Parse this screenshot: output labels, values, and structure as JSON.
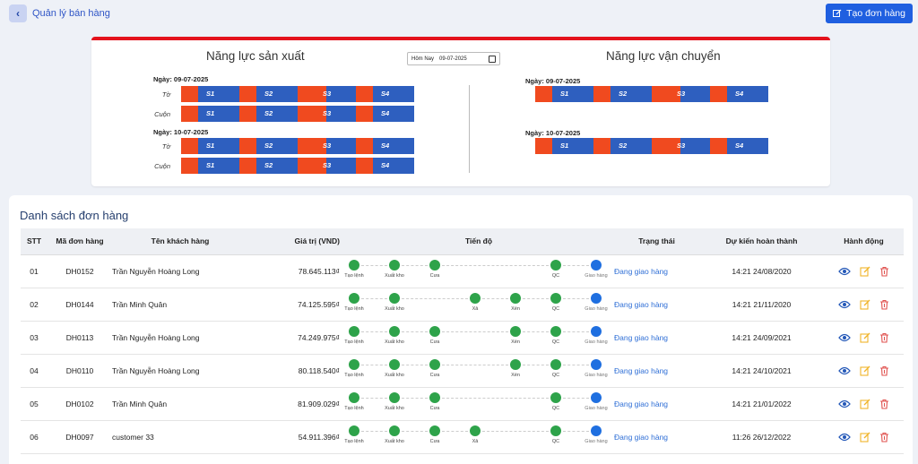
{
  "header": {
    "back_label": "Quản lý bán hàng",
    "create_label": "Tạo đơn hàng"
  },
  "capacity": {
    "production_title": "Năng lực sản xuất",
    "shipping_title": "Năng lực vận chuyển",
    "date_picker": {
      "prefix": "Hôm Nay",
      "value": "09-07-2025"
    },
    "segments": [
      "S1",
      "S2",
      "S3",
      "S4"
    ],
    "production_days": [
      {
        "label": "Ngày: 09-07-2025",
        "rows": [
          "Tờ",
          "Cuộn"
        ]
      },
      {
        "label": "Ngày: 10-07-2025",
        "rows": [
          "Tờ",
          "Cuộn"
        ]
      }
    ],
    "shipping_days": [
      {
        "label": "Ngày: 09-07-2025"
      },
      {
        "label": "Ngày: 10-07-2025"
      }
    ]
  },
  "orders": {
    "title": "Danh sách đơn hàng",
    "columns": [
      "STT",
      "Mã đơn hàng",
      "Tên khách hàng",
      "Giá trị (VND)",
      "Tiến độ",
      "Trạng thái",
      "Dự kiến hoàn thành",
      "Hành động"
    ],
    "step_names": {
      "tao": "Tạo lệnh",
      "xuat": "Xuất kho",
      "cua": "Cưa",
      "xa": "Xả",
      "xen": "Xén",
      "qc": "QC",
      "giao": "Giao hàng"
    },
    "rows": [
      {
        "stt": "01",
        "ma": "DH0152",
        "ten": "Trần Nguyễn Hoàng Long",
        "gia": "78.645.113₫",
        "steps": [
          "tao",
          "xuat",
          "cua",
          "qc",
          "giao"
        ],
        "trang_thai": "Đang giao hàng",
        "du_kien": "14:21 24/08/2020"
      },
      {
        "stt": "02",
        "ma": "DH0144",
        "ten": "Trần Minh Quân",
        "gia": "74.125.595₫",
        "steps": [
          "tao",
          "xuat",
          "xa",
          "xen",
          "qc",
          "giao"
        ],
        "trang_thai": "Đang giao hàng",
        "du_kien": "14:21 21/11/2020"
      },
      {
        "stt": "03",
        "ma": "DH0113",
        "ten": "Trần Nguyễn Hoàng Long",
        "gia": "74.249.975₫",
        "steps": [
          "tao",
          "xuat",
          "cua",
          "xen",
          "qc",
          "giao"
        ],
        "trang_thai": "Đang giao hàng",
        "du_kien": "14:21 24/09/2021"
      },
      {
        "stt": "04",
        "ma": "DH0110",
        "ten": "Trần Nguyễn Hoàng Long",
        "gia": "80.118.540₫",
        "steps": [
          "tao",
          "xuat",
          "cua",
          "xen",
          "qc",
          "giao"
        ],
        "trang_thai": "Đang giao hàng",
        "du_kien": "14:21 24/10/2021"
      },
      {
        "stt": "05",
        "ma": "DH0102",
        "ten": "Trần Minh Quân",
        "gia": "81.909.029₫",
        "steps": [
          "tao",
          "xuat",
          "cua",
          "qc",
          "giao"
        ],
        "trang_thai": "Đang giao hàng",
        "du_kien": "14:21 21/01/2022"
      },
      {
        "stt": "06",
        "ma": "DH0097",
        "ten": "customer 33",
        "gia": "54.911.396₫",
        "steps": [
          "tao",
          "xuat",
          "cua",
          "xa",
          "qc",
          "giao"
        ],
        "trang_thai": "Đang giao hàng",
        "du_kien": "11:26 26/12/2022"
      }
    ]
  },
  "colors": {
    "accent": "#1f5fe0",
    "seg_red": "#f04a1f",
    "seg_blue": "#2e5fbf",
    "done": "#2ea34a",
    "current": "#1f6fe0"
  }
}
